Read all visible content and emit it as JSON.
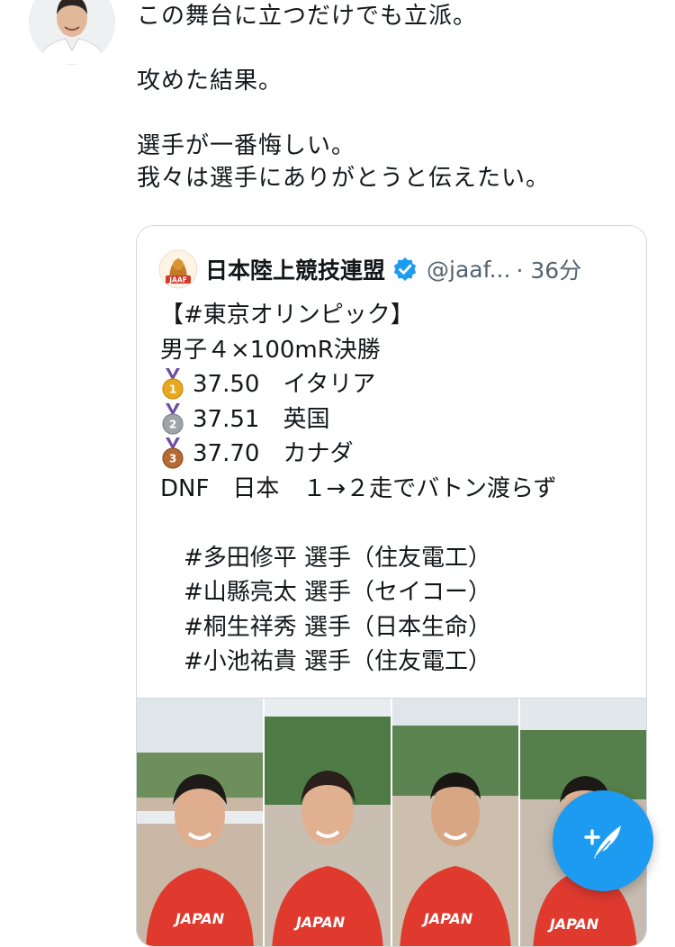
{
  "tweet": {
    "lines": [
      "この舞台に立つだけでも立派。",
      "",
      "攻めた結果。",
      "",
      "選手が一番悔しい。",
      "我々は選手にありがとうと伝えたい。"
    ]
  },
  "quote": {
    "name": "日本陸上競技連盟",
    "handle": "@jaaf...",
    "time": "· 36分",
    "logo_text": "JAAF",
    "title_line": "【#東京オリンピック】",
    "event_line": "男子４×100mR決勝",
    "results": [
      {
        "time": "37.50",
        "country": "イタリア",
        "medal": "gold",
        "place": "1"
      },
      {
        "time": "37.51",
        "country": "英国",
        "medal": "silver",
        "place": "2"
      },
      {
        "time": "37.70",
        "country": "カナダ",
        "medal": "bronze",
        "place": "3"
      }
    ],
    "dnf_line": "DNF　日本　１→２走でバトン渡らず",
    "athletes": [
      "　#多田修平 選手（住友電工）",
      "　#山縣亮太 選手（セイコー）",
      "　#桐生祥秀 選手（日本生命）",
      "　#小池祐貴 選手（住友電工）"
    ],
    "jersey_text": "JAPAN"
  },
  "colors": {
    "accent": "#1d9bf0",
    "jersey": "#e03a2f",
    "gold": "#e9a91e",
    "silver": "#9ea4a8",
    "bronze": "#b46a34",
    "ribbon": "#6f4ca5"
  },
  "icons": {
    "fab": "compose-tweet-icon",
    "verified": "verified-badge-icon"
  }
}
